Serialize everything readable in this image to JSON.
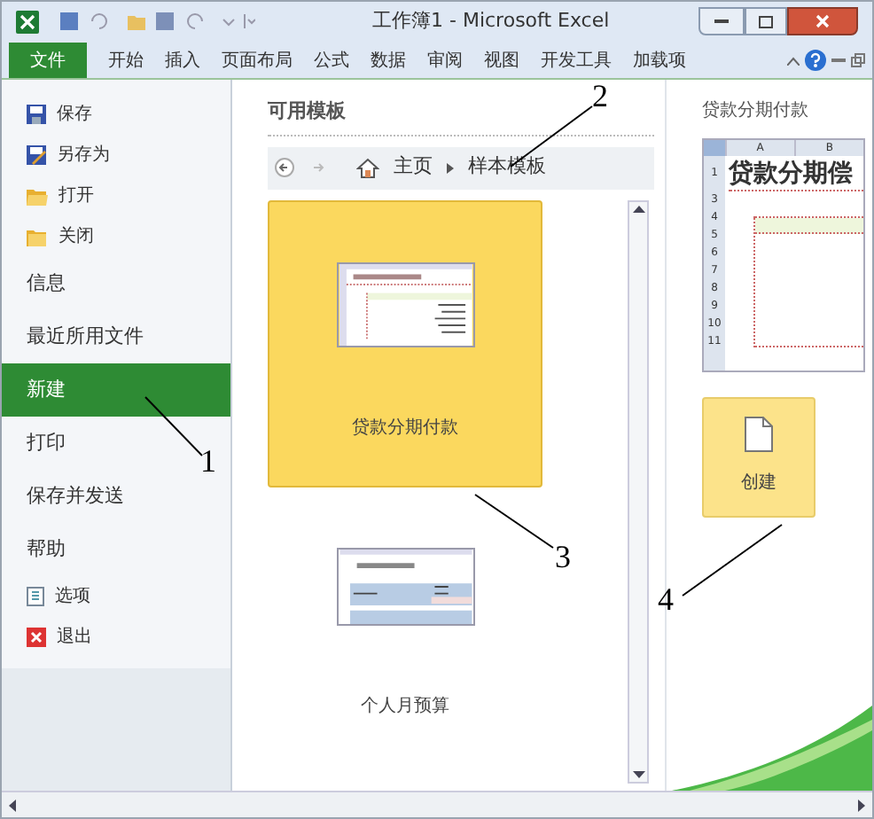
{
  "window": {
    "title": "工作簿1 - Microsoft Excel"
  },
  "ribbon_tabs": [
    {
      "label": "文件",
      "selected": true
    },
    {
      "label": "开始",
      "selected": false
    },
    {
      "label": "插入",
      "selected": false
    },
    {
      "label": "页面布局",
      "selected": false
    },
    {
      "label": "公式",
      "selected": false
    },
    {
      "label": "数据",
      "selected": false
    },
    {
      "label": "审阅",
      "selected": false
    },
    {
      "label": "视图",
      "selected": false
    },
    {
      "label": "开发工具",
      "selected": false
    },
    {
      "label": "加载项",
      "selected": false
    }
  ],
  "sidebar": {
    "items": [
      {
        "label": "保存",
        "kind": "command",
        "selected": false
      },
      {
        "label": "另存为",
        "kind": "command",
        "selected": false
      },
      {
        "label": "打开",
        "kind": "command",
        "selected": false
      },
      {
        "label": "关闭",
        "kind": "command",
        "selected": false
      },
      {
        "label": "信息",
        "kind": "page",
        "selected": false
      },
      {
        "label": "最近所用文件",
        "kind": "page",
        "selected": false
      },
      {
        "label": "新建",
        "kind": "page",
        "selected": true
      },
      {
        "label": "打印",
        "kind": "page",
        "selected": false
      },
      {
        "label": "保存并发送",
        "kind": "page",
        "selected": false
      },
      {
        "label": "帮助",
        "kind": "page",
        "selected": false
      },
      {
        "label": "选项",
        "kind": "command",
        "selected": false
      },
      {
        "label": "退出",
        "kind": "command",
        "selected": false
      }
    ]
  },
  "templates": {
    "heading": "可用模板",
    "breadcrumb": [
      "主页",
      "样本模板"
    ],
    "items": [
      {
        "label": "贷款分期付款",
        "selected": true
      },
      {
        "label": "个人月预算",
        "selected": false
      }
    ]
  },
  "preview": {
    "title": "贷款分期付款",
    "sheet_title": "贷款分期偿",
    "columns": [
      "A",
      "B"
    ],
    "row_numbers": [
      "1",
      "3",
      "4",
      "5",
      "6",
      "7",
      "8",
      "9",
      "10",
      "11"
    ],
    "create_button": "创建"
  },
  "callouts": [
    {
      "label": "1"
    },
    {
      "label": "2"
    },
    {
      "label": "3"
    },
    {
      "label": "4"
    }
  ]
}
